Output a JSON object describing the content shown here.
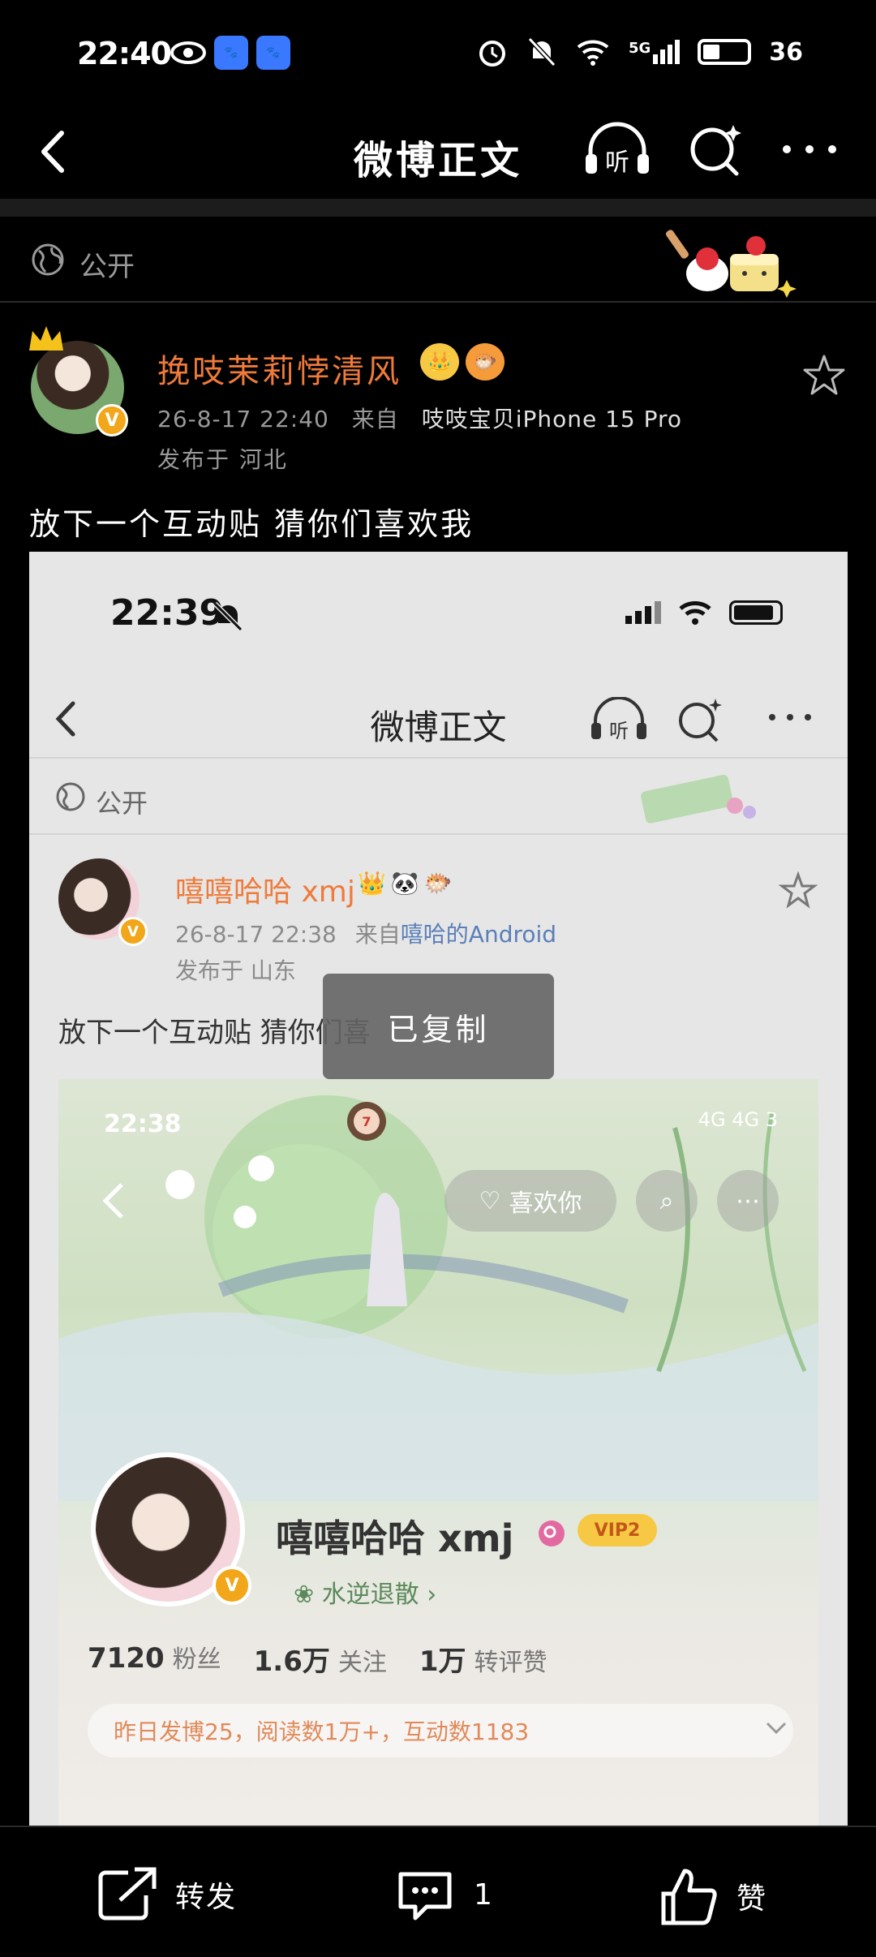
{
  "status_bar": {
    "time": "22:40",
    "network": "5G",
    "battery": "36",
    "apps": [
      "du",
      "du"
    ]
  },
  "nav": {
    "title": "微博正文",
    "listen_label": "听"
  },
  "visibility": {
    "label": "公开"
  },
  "post": {
    "username": "挽吱茉莉悖清风",
    "badges": [
      "crown-badge",
      "fish-badge"
    ],
    "time": "26-8-17 22:40",
    "from_prefix": "来自",
    "source": "吱吱宝贝iPhone 15 Pro",
    "location": "发布于 河北",
    "text": "放下一个互动贴 猜你们喜欢我"
  },
  "embedded": {
    "time": "22:39",
    "nav_title": "微博正文",
    "listen_label": "听",
    "visibility": "公开",
    "username": "嘻嘻哈哈 xmj",
    "meta_time": "26-8-17 22:38",
    "from_prefix": "来自",
    "source": "嘻哈的Android",
    "location": "发布于 山东",
    "text": "放下一个互动贴 猜你们喜",
    "toast": "已复制",
    "profile": {
      "time": "22:38",
      "status_right": "4G 4G 3",
      "like_button": "喜欢你",
      "name": "嘻嘻哈哈 xmj",
      "vip": "VIP2",
      "tag": "水逆退散 ›",
      "stats": [
        {
          "value": "7120",
          "label": "粉丝"
        },
        {
          "value": "1.6万",
          "label": "关注"
        },
        {
          "value": "1万",
          "label": "转评赞"
        }
      ],
      "info": "昨日发博25，阅读数1万+，互动数1183"
    }
  },
  "actions": {
    "repost": "转发",
    "comment_count": "1",
    "like": "赞"
  },
  "colors": {
    "username": "#ef7b3b",
    "v_badge": "#f2a619",
    "background": "#000000"
  }
}
